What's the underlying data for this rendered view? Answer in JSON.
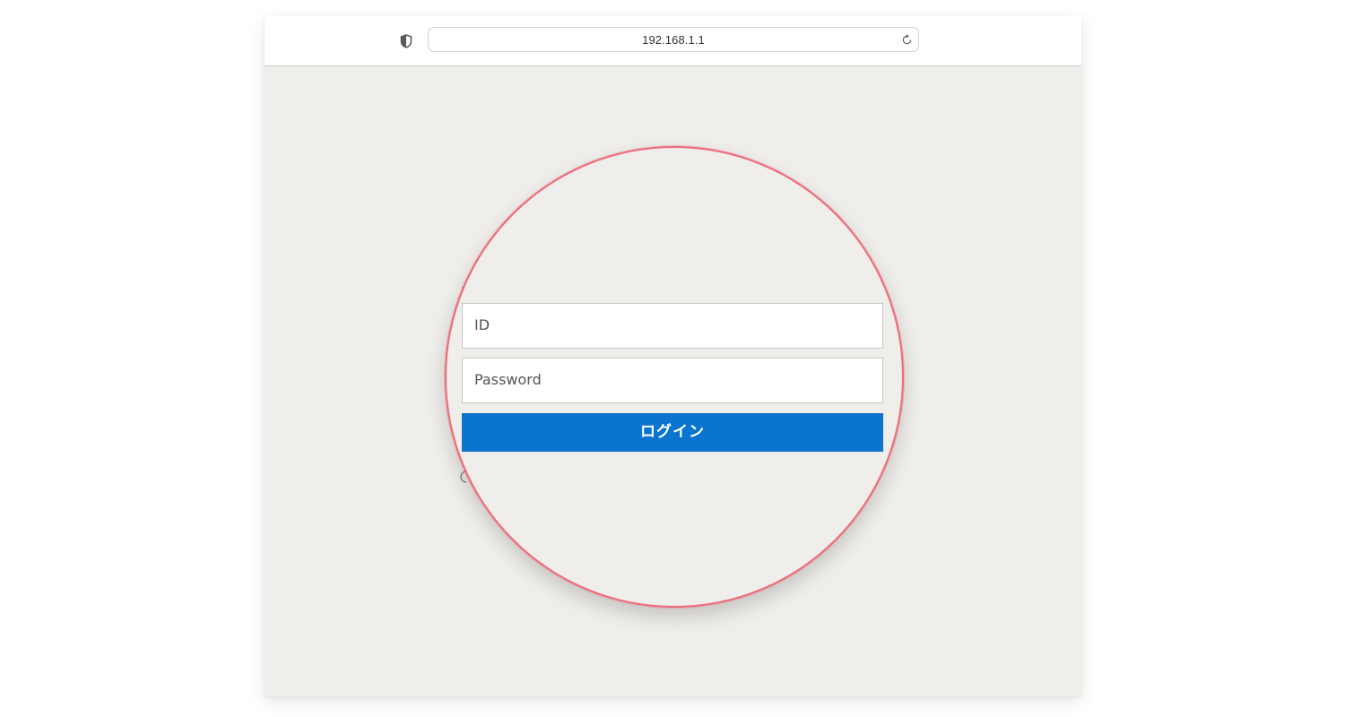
{
  "browser": {
    "url": "192.168.1.1",
    "shield_icon": "shield-icon",
    "reload_icon": "reload-icon"
  },
  "login_form": {
    "id_placeholder": "ID",
    "password_placeholder": "Password",
    "login_label": "ログイン"
  },
  "colors": {
    "login_button": "#0a74ce",
    "magnifier_border": "#ee6b7a",
    "page_background": "#f0eeeb"
  }
}
